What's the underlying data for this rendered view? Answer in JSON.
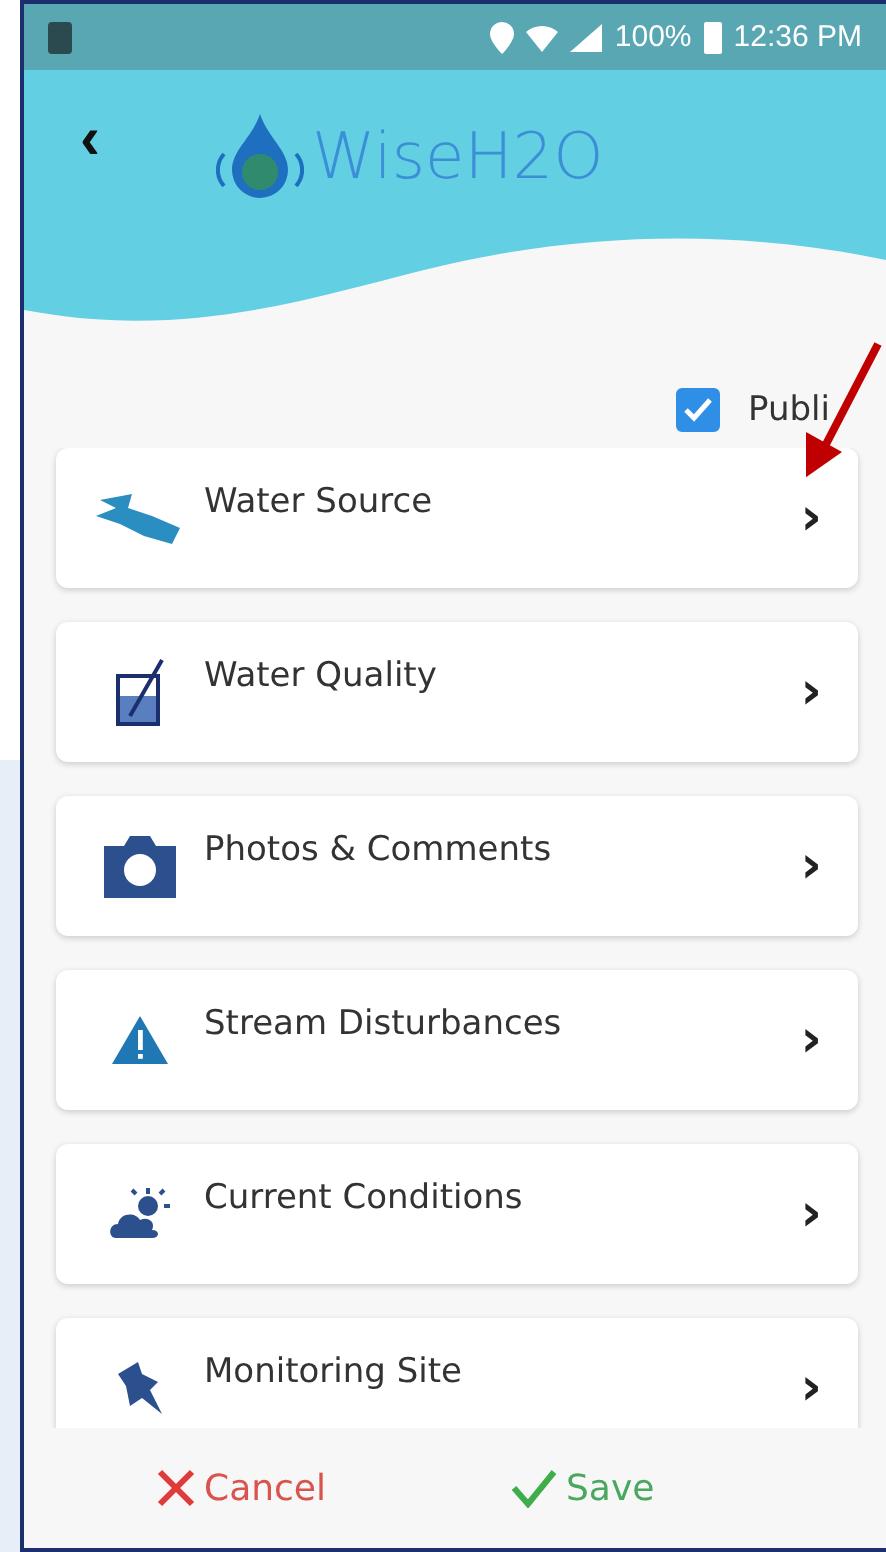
{
  "status_bar": {
    "battery_text": "100%",
    "time": "12:36 PM"
  },
  "header": {
    "back": "‹",
    "logo_text": "WiseH2O"
  },
  "public_checkbox": {
    "label": "Publi",
    "checked": true
  },
  "items": [
    {
      "kind": "water",
      "label": "Water Source",
      "chevron": "›"
    },
    {
      "kind": "beaker",
      "label": "Water Quality",
      "chevron": "›"
    },
    {
      "kind": "camera",
      "label": "Photos & Comments",
      "chevron": "›"
    },
    {
      "kind": "warning",
      "label": "Stream Disturbances",
      "chevron": "›"
    },
    {
      "kind": "weather",
      "label": "Current Conditions",
      "chevron": "›"
    },
    {
      "kind": "pin",
      "label": "Monitoring Site",
      "chevron": "›"
    }
  ],
  "footer": {
    "cancel": "Cancel",
    "save": "Save"
  }
}
